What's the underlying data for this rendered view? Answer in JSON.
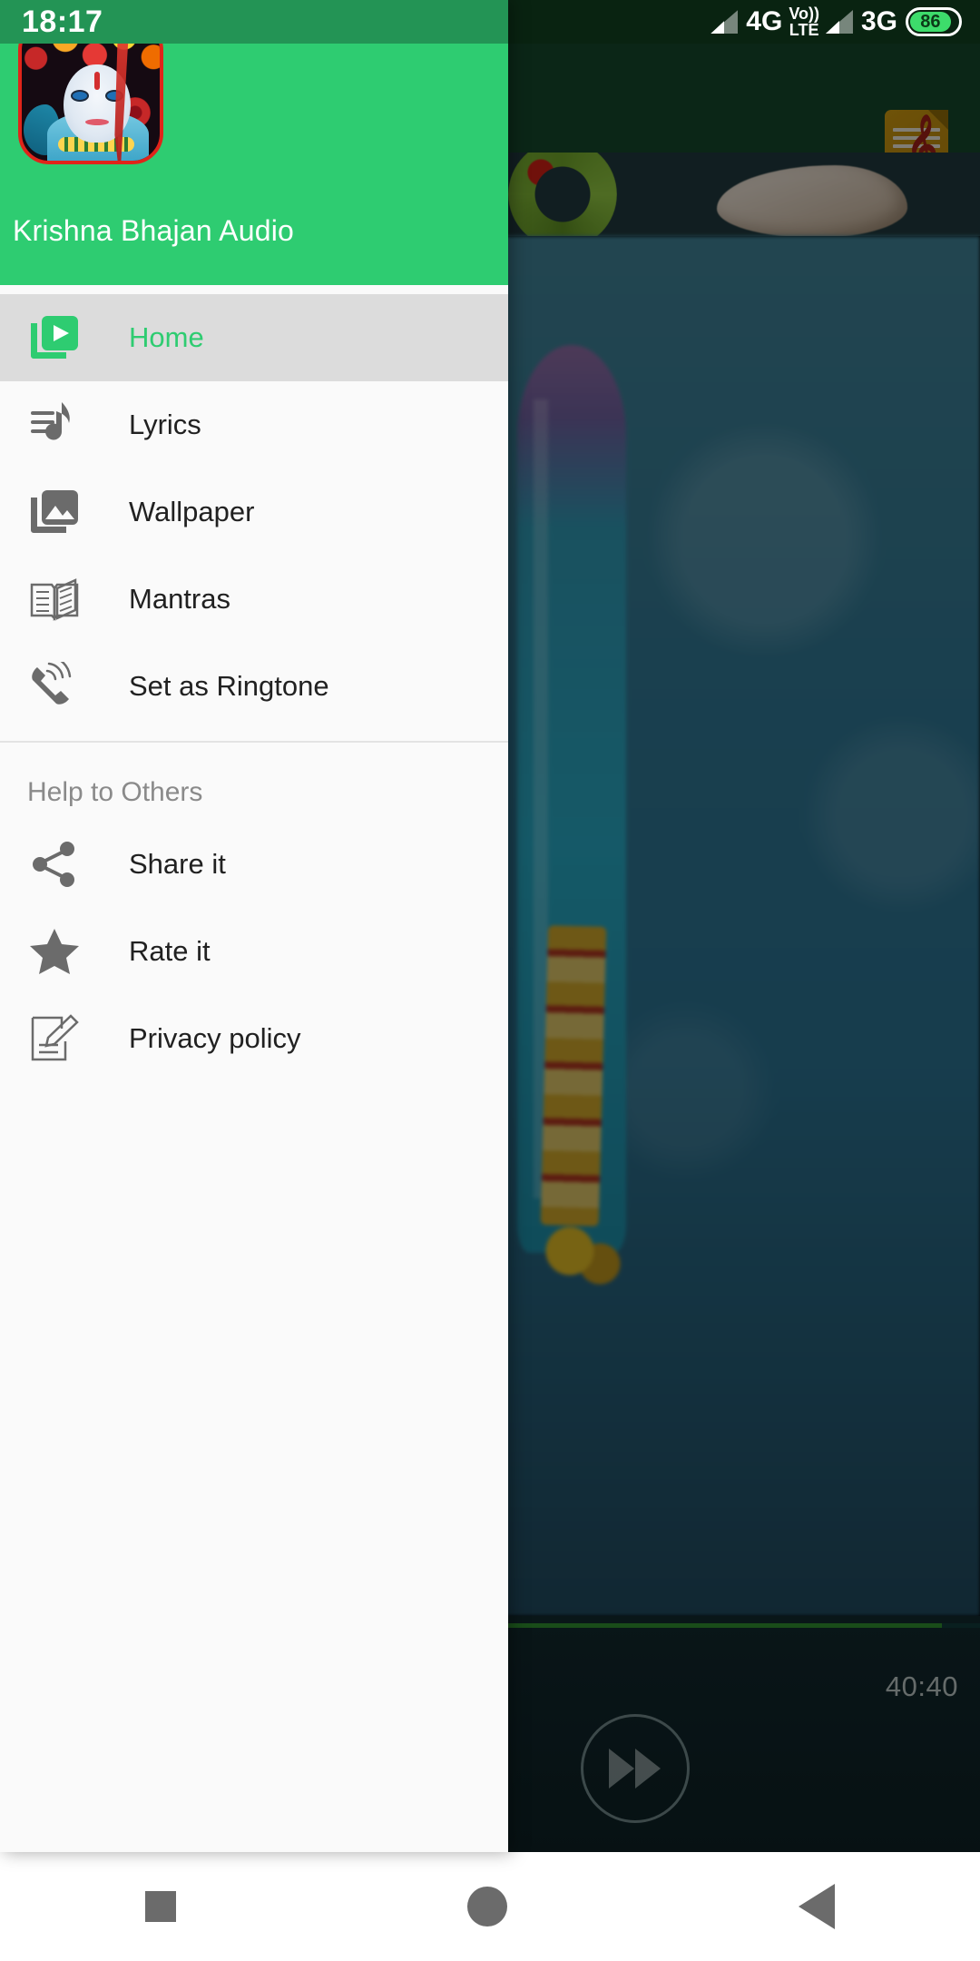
{
  "status_bar": {
    "time": "18:17",
    "sim1_network": "4G",
    "volte_top": "Vo))",
    "volte_bottom": "LTE",
    "sim2_network": "3G",
    "battery_percent": "86"
  },
  "drawer": {
    "app_title": "Krishna Bhajan Audio",
    "app_icon_name": "krishna-app-icon",
    "menu_items": [
      {
        "label": "Home",
        "icon": "video-library-icon",
        "selected": true
      },
      {
        "label": "Lyrics",
        "icon": "music-note-lyrics-icon",
        "selected": false
      },
      {
        "label": "Wallpaper",
        "icon": "photo-library-icon",
        "selected": false
      },
      {
        "label": "Mantras",
        "icon": "open-book-icon",
        "selected": false
      },
      {
        "label": "Set as Ringtone",
        "icon": "ringing-phone-icon",
        "selected": false
      }
    ],
    "section_title": "Help to Others",
    "help_items": [
      {
        "label": "Share it",
        "icon": "share-icon"
      },
      {
        "label": "Rate it",
        "icon": "star-icon"
      },
      {
        "label": "Privacy policy",
        "icon": "document-pencil-icon"
      }
    ]
  },
  "background": {
    "toolbar_icon": "music-sheet-icon",
    "hero_items": [
      "flower-garland",
      "conch-shell"
    ],
    "player": {
      "time_remaining": "40:40",
      "forward_button": "fast-forward-icon",
      "progress_percent": 96
    }
  },
  "nav_bar": {
    "recents": "square-recents-icon",
    "home": "circle-home-icon",
    "back": "triangle-back-icon"
  },
  "colors": {
    "brand_green": "#2ecc71",
    "status_green": "#239455",
    "selected_row": "#dcdcdc",
    "drawer_bg": "#fafafa",
    "icon_grey": "#6b6b6b"
  }
}
